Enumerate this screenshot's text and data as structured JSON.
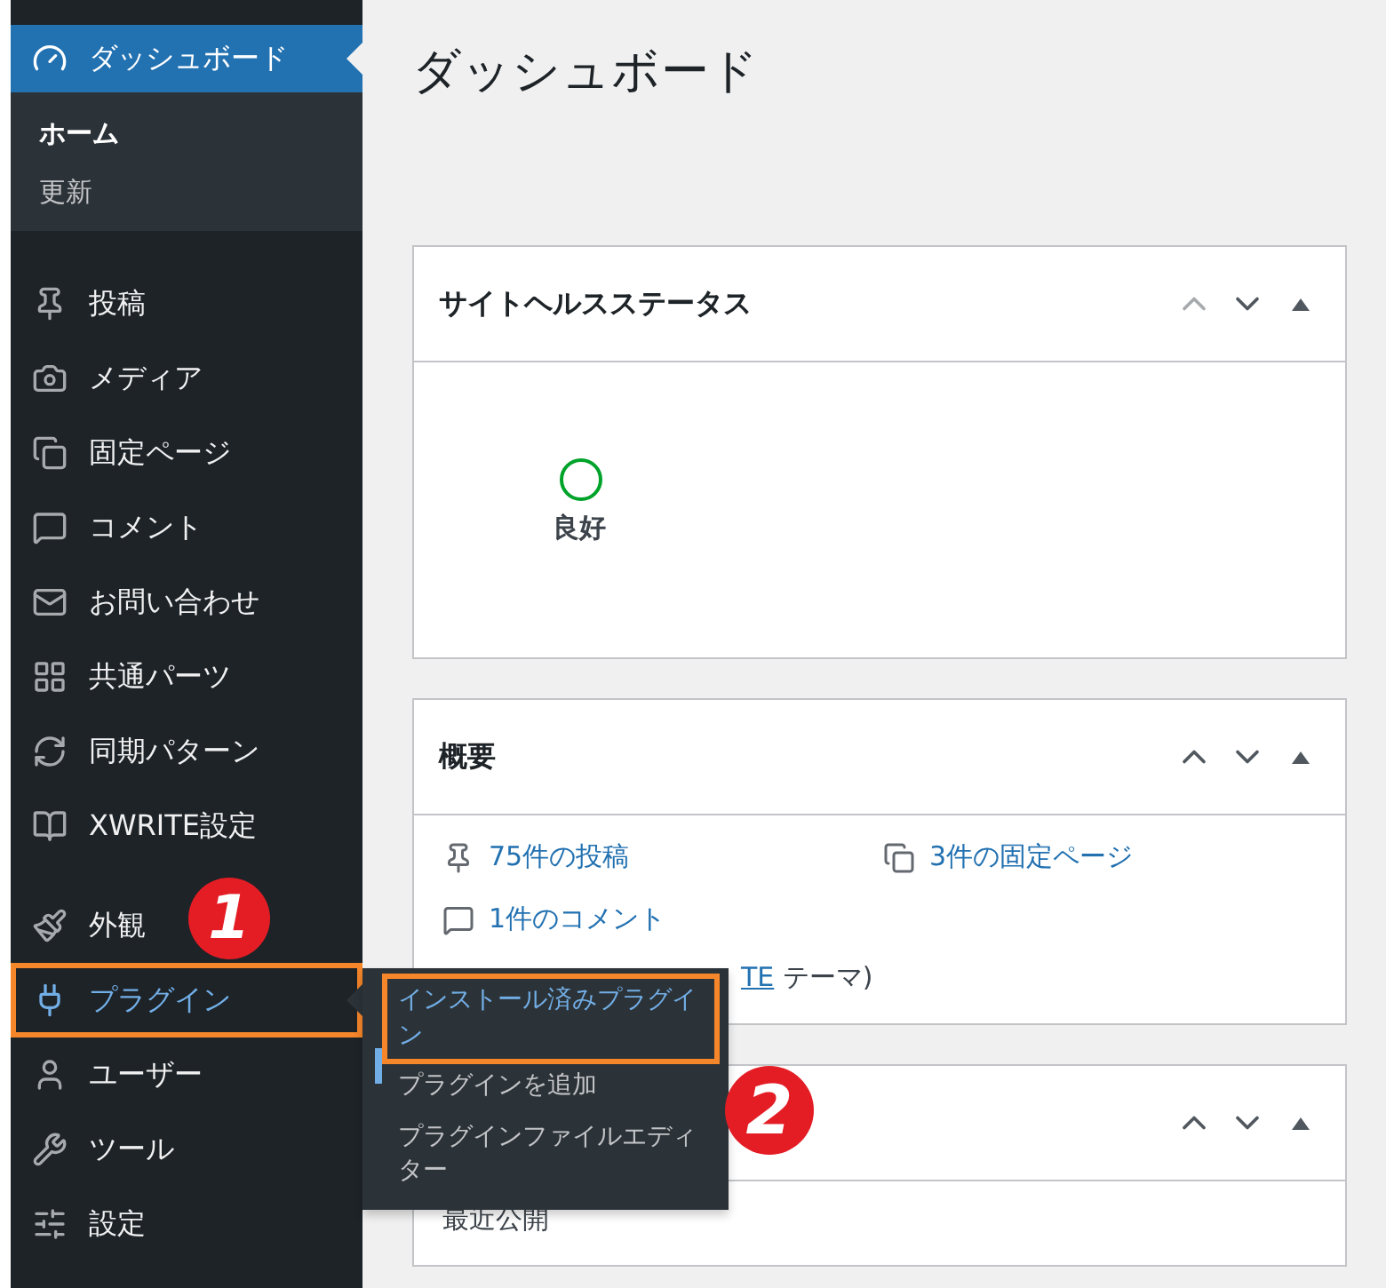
{
  "sidebar": {
    "items": [
      {
        "label": "ダッシュボード",
        "current": true,
        "highlighted": false,
        "children": [
          {
            "label": "ホーム",
            "selected": true
          },
          {
            "label": "更新",
            "selected": false
          }
        ]
      },
      {
        "label": "投稿",
        "current": false,
        "highlighted": false
      },
      {
        "label": "メディア",
        "current": false,
        "highlighted": false
      },
      {
        "label": "固定ページ",
        "current": false,
        "highlighted": false
      },
      {
        "label": "コメント",
        "current": false,
        "highlighted": false
      },
      {
        "label": "お問い合わせ",
        "current": false,
        "highlighted": false
      },
      {
        "label": "共通パーツ",
        "current": false,
        "highlighted": false
      },
      {
        "label": "同期パターン",
        "current": false,
        "highlighted": false
      },
      {
        "label": "XWRITE設定",
        "current": false,
        "highlighted": false
      },
      {
        "label": "外観",
        "current": false,
        "highlighted": false
      },
      {
        "label": "プラグイン",
        "current": false,
        "highlighted": true,
        "flyout": [
          {
            "label": "インストール済みプラグイン",
            "highlighted": true
          },
          {
            "label": "プラグインを追加",
            "highlighted": false
          },
          {
            "label": "プラグインファイルエディター",
            "highlighted": false
          }
        ]
      },
      {
        "label": "ユーザー",
        "current": false,
        "highlighted": false
      },
      {
        "label": "ツール",
        "current": false,
        "highlighted": false
      },
      {
        "label": "設定",
        "current": false,
        "highlighted": false
      }
    ]
  },
  "page_title": "ダッシュボード",
  "site_health": {
    "title": "サイトヘルスステータス",
    "status": "良好"
  },
  "overview": {
    "title": "概要",
    "stats": [
      {
        "label": "75件の投稿"
      },
      {
        "label": "3件の固定ページ"
      },
      {
        "label": "1件のコメント"
      }
    ],
    "theme_link": "TE",
    "theme_suffix": " テーマ)"
  },
  "activity": {
    "body": "最近公開"
  },
  "annotations": [
    {
      "label": "1"
    },
    {
      "label": "2"
    }
  ]
}
